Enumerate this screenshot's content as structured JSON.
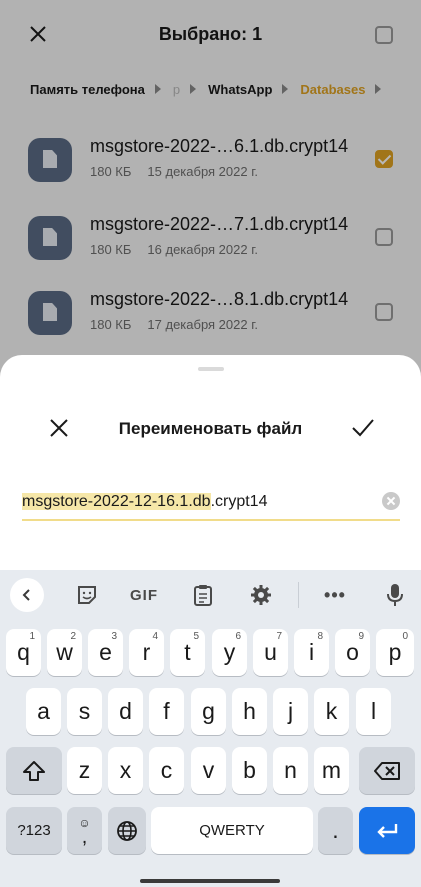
{
  "header": {
    "title": "Выбрано: 1"
  },
  "breadcrumbs": [
    {
      "label": "Память телефона",
      "state": "normal"
    },
    {
      "label": "р",
      "state": "faded"
    },
    {
      "label": "WhatsApp",
      "state": "normal"
    },
    {
      "label": "Databases",
      "state": "active"
    }
  ],
  "files": [
    {
      "name": "msgstore-2022-…6.1.db.crypt14",
      "size": "180 КБ",
      "date": "15 декабря 2022 г.",
      "checked": true
    },
    {
      "name": "msgstore-2022-…7.1.db.crypt14",
      "size": "180 КБ",
      "date": "16 декабря 2022 г.",
      "checked": false
    },
    {
      "name": "msgstore-2022-…8.1.db.crypt14",
      "size": "180 КБ",
      "date": "17 декабря 2022 г.",
      "checked": false
    }
  ],
  "dialog": {
    "title": "Переименовать файл",
    "input_selected": "msgstore-2022-12-16.1.db",
    "input_rest": ".crypt14"
  },
  "keyboard": {
    "toolbar": {
      "gif": "GIF",
      "more": "•••"
    },
    "row1": [
      {
        "k": "q",
        "h": "1"
      },
      {
        "k": "w",
        "h": "2"
      },
      {
        "k": "e",
        "h": "3"
      },
      {
        "k": "r",
        "h": "4"
      },
      {
        "k": "t",
        "h": "5"
      },
      {
        "k": "y",
        "h": "6"
      },
      {
        "k": "u",
        "h": "7"
      },
      {
        "k": "i",
        "h": "8"
      },
      {
        "k": "o",
        "h": "9"
      },
      {
        "k": "p",
        "h": "0"
      }
    ],
    "row2": [
      "a",
      "s",
      "d",
      "f",
      "g",
      "h",
      "j",
      "k",
      "l"
    ],
    "row3": [
      "z",
      "x",
      "c",
      "v",
      "b",
      "n",
      "m"
    ],
    "symbols_label": "?123",
    "comma": ",",
    "space_label": "QWERTY",
    "period": "."
  },
  "colors": {
    "accent": "#e0a323",
    "selection": "#f6e7a8",
    "enter": "#1a73e8"
  }
}
